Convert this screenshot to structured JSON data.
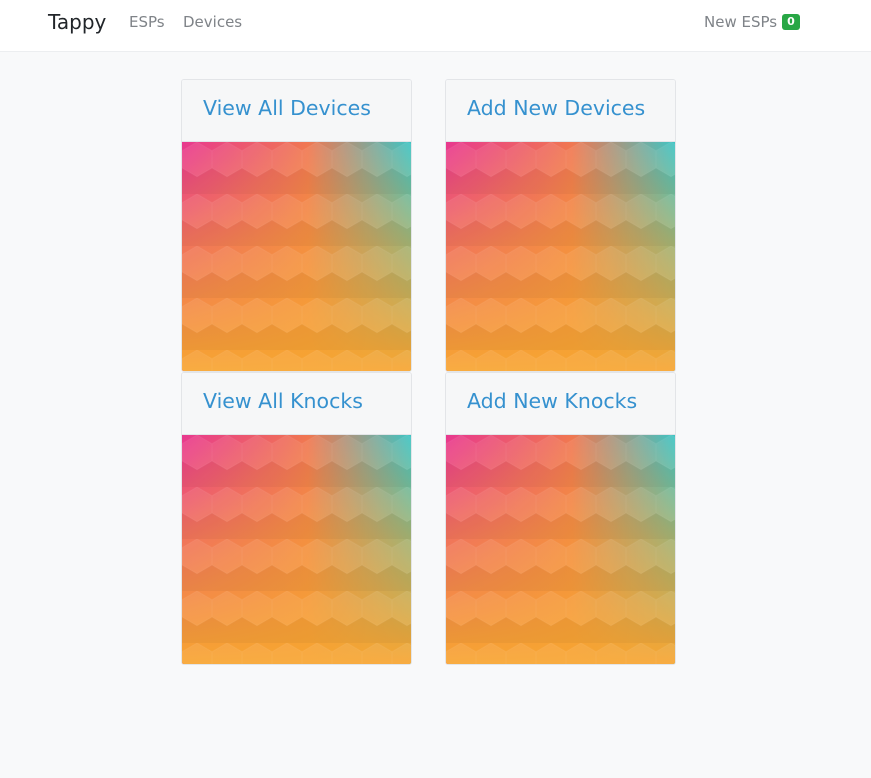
{
  "navbar": {
    "brand": "Tappy",
    "links": [
      "ESPs",
      "Devices"
    ],
    "new_esps_label": "New ESPs",
    "new_esps_count": "0"
  },
  "cards": [
    {
      "title": "View All Devices"
    },
    {
      "title": "Add New Devices"
    },
    {
      "title": "View All Knocks"
    },
    {
      "title": "Add New Knocks"
    }
  ],
  "colors": {
    "link": "#3591cf",
    "badge": "#28a745",
    "gradient_pink": "#e8388f",
    "gradient_orange": "#f7a531",
    "gradient_teal": "#3ec4c4"
  }
}
